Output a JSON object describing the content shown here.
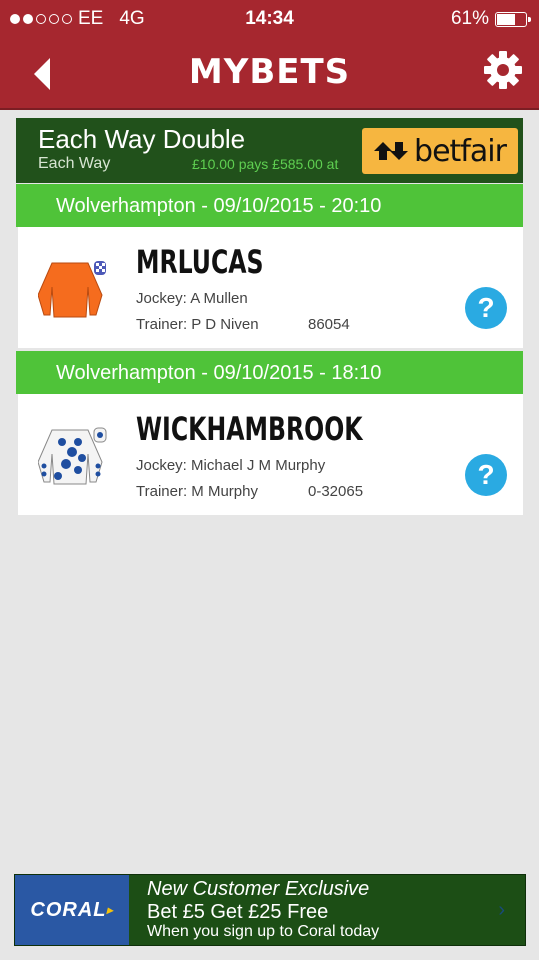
{
  "status": {
    "carrier": "EE",
    "network": "4G",
    "time": "14:34",
    "battery": "61%"
  },
  "header": {
    "title": "MYBETS"
  },
  "bet": {
    "type": "Each Way Double",
    "subtype": "Each Way",
    "pays": "£10.00 pays £585.00 at",
    "bookmaker": "betfair"
  },
  "selections": [
    {
      "race": "Wolverhampton - 09/10/2015 - 20:10",
      "horse": "MRLUCAS",
      "jockey": "Jockey: A Mullen",
      "trainer": "Trainer: P D Niven",
      "form": "86054",
      "help": "?"
    },
    {
      "race": "Wolverhampton - 09/10/2015 - 18:10",
      "horse": "WICKHAMBROOK",
      "jockey": "Jockey: Michael J M Murphy",
      "trainer": "Trainer: M Murphy",
      "form": "0-32065",
      "help": "?"
    }
  ],
  "ad": {
    "brand": "CORAL",
    "line1": "New Customer Exclusive",
    "line2": "Bet £5 Get £25 Free",
    "line3": "When you sign up to Coral today"
  },
  "colors": {
    "topbar": "#a6272f",
    "bet_header": "#21511b",
    "race_bar": "#4fc339",
    "help": "#2aaae2",
    "betfair": "#f6b640"
  }
}
